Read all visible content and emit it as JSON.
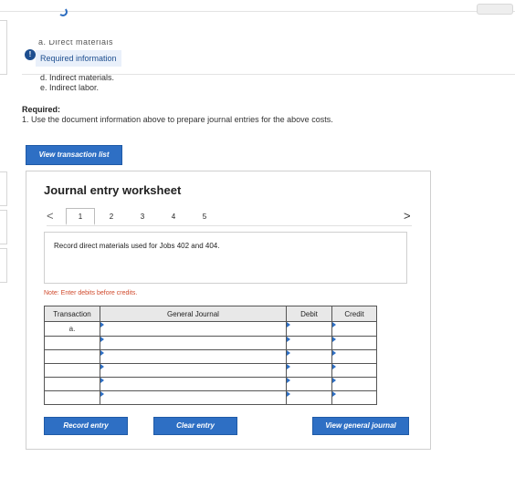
{
  "required_info": {
    "cut_text": "a. Direct materials",
    "tab_label": "Required information",
    "alert_glyph": "!",
    "items": [
      "d. Indirect materials.",
      "e. Indirect labor."
    ]
  },
  "required": {
    "title": "Required:",
    "text": "1. Use the document information above to prepare journal entries for the above costs."
  },
  "buttons": {
    "view_transaction_list": "View transaction list",
    "record_entry": "Record entry",
    "clear_entry": "Clear entry",
    "view_general_journal": "View general journal"
  },
  "worksheet": {
    "title": "Journal entry worksheet",
    "prev_glyph": "<",
    "next_glyph": ">",
    "pages": [
      "1",
      "2",
      "3",
      "4",
      "5"
    ],
    "active_page": "1",
    "description": "Record direct materials used for Jobs 402 and 404.",
    "note": "Note: Enter debits before credits.",
    "table": {
      "headers": [
        "Transaction",
        "General Journal",
        "Debit",
        "Credit"
      ],
      "first_transaction": "a."
    }
  },
  "colors": {
    "accent": "#2e6fc4",
    "note": "#d04a2c",
    "info_tab": "#e9f0fa"
  }
}
